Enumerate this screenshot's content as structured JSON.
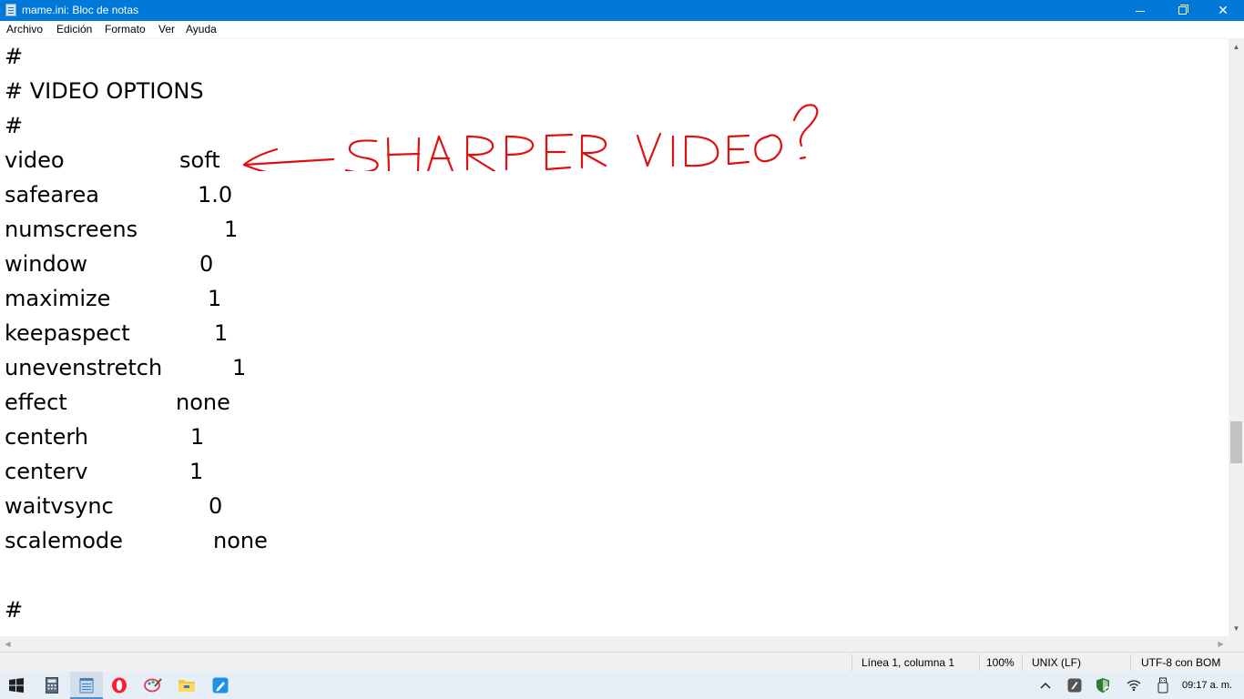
{
  "window": {
    "title": "mame.ini: Bloc de notas",
    "minimize_icon": "minimize-icon",
    "maximize_icon": "restore-icon",
    "close_label": "✕"
  },
  "menu": [
    "Archivo",
    "Edición",
    "Formato",
    "Ver",
    "Ayuda"
  ],
  "editor": {
    "lines": [
      {
        "key": "#",
        "value": ""
      },
      {
        "key": "# VIDEO OPTIONS",
        "value": ""
      },
      {
        "key": "#",
        "value": ""
      },
      {
        "key": "video",
        "value": "soft"
      },
      {
        "key": "safearea",
        "value": "1.0"
      },
      {
        "key": "numscreens",
        "value": "1"
      },
      {
        "key": "window",
        "value": "0"
      },
      {
        "key": "maximize",
        "value": "1"
      },
      {
        "key": "keepaspect",
        "value": "1"
      },
      {
        "key": "unevenstretch",
        "value": "1"
      },
      {
        "key": "effect",
        "value": "none"
      },
      {
        "key": "centerh",
        "value": "1"
      },
      {
        "key": "centerv",
        "value": "1"
      },
      {
        "key": "waitvsync",
        "value": "0"
      },
      {
        "key": "scalemode",
        "value": "none"
      },
      {
        "key": "",
        "value": ""
      },
      {
        "key": "#",
        "value": ""
      }
    ],
    "annotation": {
      "text": "SHARPER VIDEO?",
      "color": "#e01010"
    }
  },
  "statusbar": {
    "position": "Línea 1, columna 1",
    "zoom": "100%",
    "line_ending": "UNIX (LF)",
    "encoding": "UTF-8 con BOM"
  },
  "taskbar": {
    "icons": [
      "windows-start-icon",
      "calculator-icon",
      "notepad-icon",
      "opera-icon",
      "paint-icon",
      "file-explorer-icon",
      "whiteboard-icon"
    ],
    "clock": "09:17 a. m."
  },
  "colors": {
    "titlebar": "#0078d7",
    "annotation": "#e01010"
  }
}
